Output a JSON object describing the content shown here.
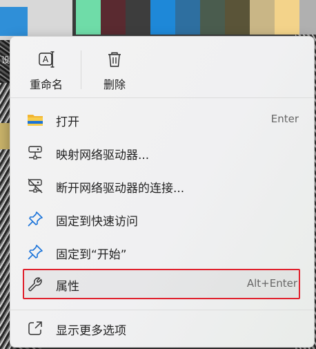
{
  "background": {
    "swatch_colors": [
      "#6fdca8",
      "#5a2a30",
      "#3d3d3d",
      "#1e88d8",
      "#2e6fa0",
      "#4a5c4e",
      "#5a5438",
      "#c9b686",
      "#f3d38a",
      "#b0b0b0"
    ],
    "left_text": "设"
  },
  "menu": {
    "top_actions": [
      {
        "label": "重命名",
        "icon": "rename-icon"
      },
      {
        "label": "删除",
        "icon": "trash-icon"
      }
    ],
    "items": [
      {
        "label": "打开",
        "shortcut": "Enter",
        "icon": "folder-icon"
      },
      {
        "label": "映射网络驱动器...",
        "shortcut": "",
        "icon": "map-network-drive-icon"
      },
      {
        "label": "断开网络驱动器的连接...",
        "shortcut": "",
        "icon": "disconnect-network-drive-icon"
      },
      {
        "label": "固定到快速访问",
        "shortcut": "",
        "icon": "pin-icon"
      },
      {
        "label": "固定到“开始”",
        "shortcut": "",
        "icon": "pin-icon"
      },
      {
        "label": "属性",
        "shortcut": "Alt+Enter",
        "icon": "wrench-icon",
        "highlighted": true
      }
    ],
    "more": {
      "label": "显示更多选项",
      "icon": "share-icon"
    },
    "accent_color": "#1a73d9",
    "highlight_color": "#e0202c"
  }
}
